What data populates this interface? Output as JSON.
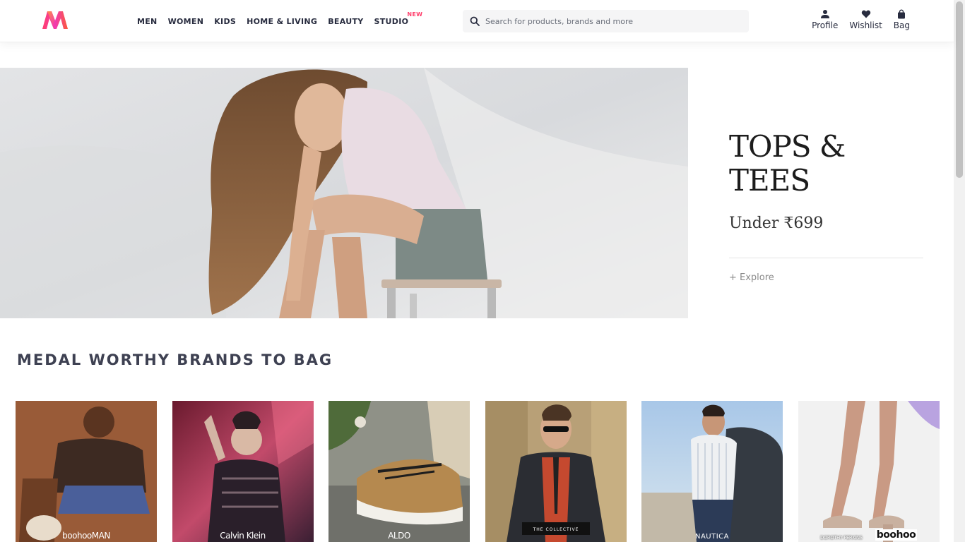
{
  "header": {
    "nav": [
      {
        "label": "MEN"
      },
      {
        "label": "WOMEN"
      },
      {
        "label": "KIDS"
      },
      {
        "label": "HOME & LIVING"
      },
      {
        "label": "BEAUTY"
      },
      {
        "label": "STUDIO",
        "badge": "NEW"
      }
    ],
    "search": {
      "placeholder": "Search for products, brands and more",
      "icon": "search-icon"
    },
    "actions": [
      {
        "label": "Profile",
        "icon": "person-icon"
      },
      {
        "label": "Wishlist",
        "icon": "heart-icon"
      },
      {
        "label": "Bag",
        "icon": "bag-icon"
      }
    ]
  },
  "hero": {
    "title": "TOPS & TEES",
    "subtitle": "Under ₹699",
    "cta": "+ Explore"
  },
  "section": {
    "title": "MEDAL WORTHY BRANDS TO BAG",
    "brands": [
      {
        "name": "boohooMAN"
      },
      {
        "name": "Calvin Klein"
      },
      {
        "name": "ALDO"
      },
      {
        "name": "THE COLLECTIVE"
      },
      {
        "name": "NAUTICA"
      },
      {
        "name": "DOROTHY PERKINS",
        "name2": "boohoo"
      }
    ]
  },
  "colors": {
    "accent": "#ff3f6c",
    "text": "#282c3f",
    "section_title": "#3e4152"
  }
}
